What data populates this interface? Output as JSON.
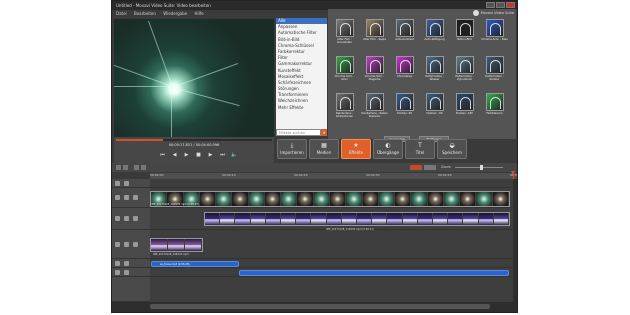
{
  "window": {
    "title": "Untitled - Movavi Video Suite: Video bearbeiten",
    "menu": [
      "Datei",
      "Bearbeiten",
      "Wiedergabe",
      "Hilfe"
    ]
  },
  "player": {
    "timecode": "00:00:17.821 / 00:04:00.096",
    "progress_fraction": 0.3
  },
  "effects": {
    "brand": "Movavi Video Suite",
    "categories": [
      "Alle",
      "Anpassen",
      "Automatische Filter",
      "Bild-in-Bild",
      "Chroma-Schlüssel",
      "Farbkorrektur",
      "Filter",
      "Gammakorrektur",
      "Kunsteffekt",
      "Mosaikeffekt",
      "Schärfezeichnen",
      "Störungen",
      "Transformieren",
      "Weichzeichnen",
      "Mehr Effekte"
    ],
    "selected_category": "Alle",
    "search_placeholder": "Effekte suchen",
    "search_button": "x",
    "tiles": [
      {
        "label": "Alter Film - Graustufen",
        "color": "#7b7b7b"
      },
      {
        "label": "Alter Film - Sepia",
        "color": "#9a8468"
      },
      {
        "label": "Auto-Kontrast",
        "color": "#5d6a74"
      },
      {
        "label": "Auto-Sättigung",
        "color": "#3d5fa0"
      },
      {
        "label": "Bild-in-Bild",
        "color": "#1c1c1c"
      },
      {
        "label": "Chroma-Schl. - Blau",
        "color": "#2f58c7"
      },
      {
        "label": "Chroma-Schl. - Grün",
        "color": "#33a844"
      },
      {
        "label": "Chroma-Schl. - Magenta",
        "color": "#c23cc5"
      },
      {
        "label": "Chromakey",
        "color": "#d130d8"
      },
      {
        "label": "Deformation - Wasser",
        "color": "#4a6f93"
      },
      {
        "label": "Deformation - Zylindrisch",
        "color": "#597d8f"
      },
      {
        "label": "Deformation - Konkav",
        "color": "#3b5c7a"
      },
      {
        "label": "Deinterlace - Interpolieren",
        "color": "#6e6e6e"
      },
      {
        "label": "Deinterlace - Zeilen kopieren",
        "color": "#5e6a73"
      },
      {
        "label": "Drehen: 90",
        "color": "#3a5a8a"
      },
      {
        "label": "Drehen: -90",
        "color": "#3e5f7a"
      },
      {
        "label": "Drehen: 180",
        "color": "#2d4a6a"
      },
      {
        "label": "Farbbalance",
        "color": "#30b050"
      }
    ],
    "apply_button": "Anwenden",
    "remove_button": "Entfernen"
  },
  "tabs": [
    {
      "label": "Importieren",
      "icon": "import-icon",
      "glyph": "⤓"
    },
    {
      "label": "Medien",
      "icon": "media-icon",
      "glyph": "▦"
    },
    {
      "label": "Effekte",
      "icon": "effects-icon",
      "glyph": "★"
    },
    {
      "label": "Übergänge",
      "icon": "transitions-icon",
      "glyph": "◐"
    },
    {
      "label": "Titel",
      "icon": "title-icon",
      "glyph": "T"
    },
    {
      "label": "Speichern",
      "icon": "save-icon",
      "glyph": "◒"
    }
  ],
  "active_tab": "Effekte",
  "timeline": {
    "zoom_label": "Zoom",
    "ruler": [
      "00:00:00",
      "00:00:10",
      "00:00:20",
      "00:00:30",
      "00:00:40",
      "00:00:50"
    ],
    "clips": {
      "video1": "IMP_20170128_102535.mp4 (0:05:07)",
      "video2": "IMP_20170128_110930.mp4 (0:00:21)",
      "video3": "IMP_20170128_105043.mp4"
    },
    "audio": {
      "clip1": "ex_trans.mp3 (2:05:28)"
    }
  }
}
